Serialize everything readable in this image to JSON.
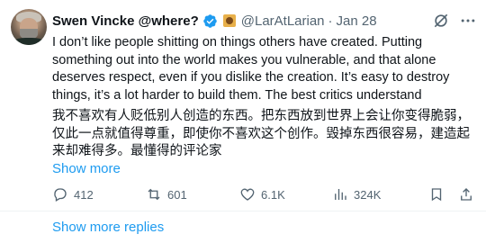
{
  "tweet": {
    "author_name": "Swen Vincke @where?",
    "handle": "@LarAtLarian",
    "separator": "·",
    "date": "Jan 28",
    "text_en": "I don’t like people shitting on things others have created. Putting something out into the world makes you vulnerable, and that alone deserves respect, even if you dislike the creation. It’s easy to destroy things, it’s a lot harder to build them. The best critics understand",
    "text_zh": "我不喜欢有人贬低别人创造的东西。把东西放到世界上会让你变得脆弱，仅此一点就值得尊重，即使你不喜欢这个创作。毁掉东西很容易，建造起来却难得多。最懂得的评论家",
    "show_more": "Show more"
  },
  "actions": {
    "replies": "412",
    "reposts": "601",
    "likes": "6.1K",
    "views": "324K"
  },
  "footer": {
    "more_replies": "Show more replies"
  },
  "icons": {
    "verified": "verified-badge-icon",
    "affiliate": "affiliate-badge-icon",
    "grok": "grok-icon",
    "more": "more-options-icon",
    "reply": "reply-icon",
    "repost": "repost-icon",
    "like": "like-icon",
    "views": "views-icon",
    "bookmark": "bookmark-icon",
    "share": "share-icon"
  },
  "colors": {
    "text": "#0f1419",
    "secondary": "#536471",
    "accent": "#1d9bf0"
  }
}
